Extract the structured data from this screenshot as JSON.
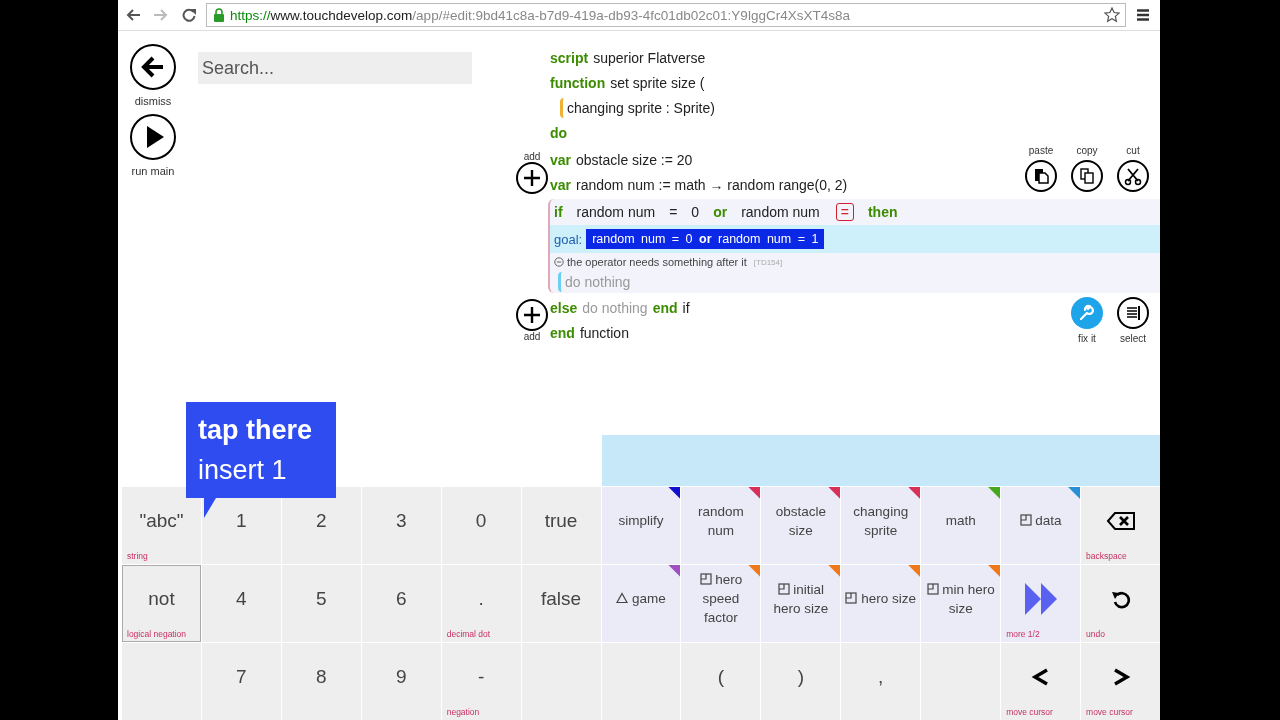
{
  "browser": {
    "buttons": [
      {
        "disabled": false
      },
      {
        "disabled": true
      },
      {
        "disabled": false
      }
    ],
    "url": {
      "scheme": "https://",
      "host": "www.touchdevelop.com",
      "path": "/app/#edit:9bd41c8a-b7d9-419a-db93-4fc01db02c01:Y9lggCr4XsXT4s8a"
    }
  },
  "side_buttons": [
    {
      "label": "dismiss"
    },
    {
      "label": "run main"
    }
  ],
  "search": {
    "placeholder": "Search..."
  },
  "editor": {
    "header": [
      {
        "tokens": [
          {
            "kind": "keyword",
            "text": "script"
          },
          {
            "kind": "name",
            "text": "superior Flatverse"
          }
        ]
      },
      {
        "tokens": [
          {
            "kind": "keyword",
            "text": "function"
          },
          {
            "kind": "name",
            "text": "set sprite size ("
          }
        ]
      },
      {
        "tokens": [
          {
            "kind": "name",
            "text": "changing sprite : Sprite)"
          }
        ]
      },
      {
        "tokens": [
          {
            "kind": "keyword",
            "text": "do"
          }
        ]
      }
    ],
    "add_buttons": [
      {
        "label": "add",
        "kind": "above"
      },
      {
        "label": "add",
        "kind": "below"
      }
    ],
    "declarations": [
      {
        "tokens": [
          {
            "kind": "keyword",
            "text": "var"
          },
          {
            "kind": "name",
            "text": "obstacle size := 20"
          }
        ]
      },
      {
        "tokens": [
          {
            "kind": "keyword",
            "text": "var"
          },
          {
            "kind": "name",
            "text": "random num := math → random range(0, 2)"
          }
        ]
      }
    ],
    "edit_actions": [
      {
        "label": "paste"
      },
      {
        "label": "copy"
      },
      {
        "label": "cut"
      }
    ],
    "if_block": {
      "condition": [
        {
          "kind": "keyword",
          "text": "if"
        },
        {
          "kind": "name",
          "text": "random num"
        },
        {
          "kind": "name",
          "text": "="
        },
        {
          "kind": "name",
          "text": "0"
        },
        {
          "kind": "keyword",
          "text": "or"
        },
        {
          "kind": "name",
          "text": "random num"
        },
        {
          "kind": "error-op",
          "text": "="
        },
        {
          "kind": "keyword",
          "text": "then"
        }
      ],
      "goal": {
        "label": "goal:",
        "expression": "random num = 0 **or** random num = 1"
      },
      "error": {
        "message": "the operator needs something after it",
        "code": "[TD154]"
      },
      "body": {
        "tokens": [
          {
            "kind": "placeholder",
            "text": "do nothing"
          }
        ]
      }
    },
    "footer": [
      {
        "tokens": [
          {
            "kind": "keyword",
            "text": "else"
          },
          {
            "kind": "placeholder",
            "text": "do nothing"
          },
          {
            "kind": "keyword",
            "text": "end"
          },
          {
            "kind": "name",
            "text": "if"
          }
        ]
      },
      {
        "tokens": [
          {
            "kind": "keyword",
            "text": "end"
          },
          {
            "kind": "name",
            "text": "function"
          }
        ]
      }
    ],
    "fix_actions": [
      {
        "label": "fix it"
      },
      {
        "label": "select"
      }
    ]
  },
  "tooltip": {
    "title": "tap there",
    "text": "insert 1"
  },
  "keyboard": {
    "rows": [
      [
        {
          "kind": "plain",
          "label": "\"abc\"",
          "hint": "string",
          "selected": false
        },
        {
          "kind": "plain",
          "label": "1",
          "selected": false
        },
        {
          "kind": "plain",
          "label": "2",
          "selected": false
        },
        {
          "kind": "plain",
          "label": "3",
          "selected": false
        },
        {
          "kind": "plain",
          "label": "0",
          "selected": false
        },
        {
          "kind": "plain",
          "label": "true",
          "selected": false
        },
        {
          "kind": "token",
          "label": "simplify",
          "color": "#1010d0",
          "selected": false
        },
        {
          "kind": "token",
          "label": "random num",
          "color": "#d8305a",
          "selected": false
        },
        {
          "kind": "token",
          "label": "obstacle size",
          "color": "#d8305a",
          "selected": false
        },
        {
          "kind": "token",
          "label": "changing sprite",
          "color": "#d8305a",
          "selected": false
        },
        {
          "kind": "token",
          "label": "math",
          "color": "#44a820",
          "selected": false
        },
        {
          "kind": "field",
          "label": "data",
          "color": "#2890d8",
          "selected": false
        },
        {
          "kind": "action",
          "hint": "backspace",
          "selected": false
        }
      ],
      [
        {
          "kind": "plain",
          "label": "not",
          "hint": "logical negation",
          "selected": true
        },
        {
          "kind": "plain",
          "label": "4",
          "selected": false
        },
        {
          "kind": "plain",
          "label": "5",
          "selected": false
        },
        {
          "kind": "plain",
          "label": "6",
          "selected": false
        },
        {
          "kind": "plain",
          "label": ".",
          "hint": "decimal dot",
          "selected": false
        },
        {
          "kind": "plain",
          "label": "false",
          "selected": false
        },
        {
          "kind": "library",
          "label": "game",
          "color": "#a050c0",
          "selected": false
        },
        {
          "kind": "field",
          "label": "hero speed factor",
          "color": "#f07818",
          "selected": false
        },
        {
          "kind": "field",
          "label": "initial hero size",
          "color": "#f07818",
          "selected": false
        },
        {
          "kind": "field",
          "label": "hero size",
          "color": "#f07818",
          "selected": false
        },
        {
          "kind": "field",
          "label": "min hero size",
          "color": "#f07818",
          "selected": false
        },
        {
          "kind": "more",
          "hint": "more 1/2",
          "selected": false
        },
        {
          "kind": "action",
          "hint": "undo",
          "selected": false
        }
      ],
      [
        {
          "kind": "blank",
          "selected": false
        },
        {
          "kind": "plain",
          "label": "7",
          "selected": false
        },
        {
          "kind": "plain",
          "label": "8",
          "selected": false
        },
        {
          "kind": "plain",
          "label": "9",
          "selected": false
        },
        {
          "kind": "plain",
          "label": "-",
          "hint": "negation",
          "selected": false
        },
        {
          "kind": "blank",
          "selected": false
        },
        {
          "kind": "blank",
          "selected": false
        },
        {
          "kind": "plain",
          "label": "(",
          "selected": false
        },
        {
          "kind": "plain",
          "label": ")",
          "selected": false
        },
        {
          "kind": "plain",
          "label": ",",
          "selected": false
        },
        {
          "kind": "blank",
          "selected": false
        },
        {
          "kind": "action",
          "hint": "move cursor",
          "selected": false
        },
        {
          "kind": "action",
          "hint": "move cursor",
          "selected": false
        }
      ]
    ]
  }
}
